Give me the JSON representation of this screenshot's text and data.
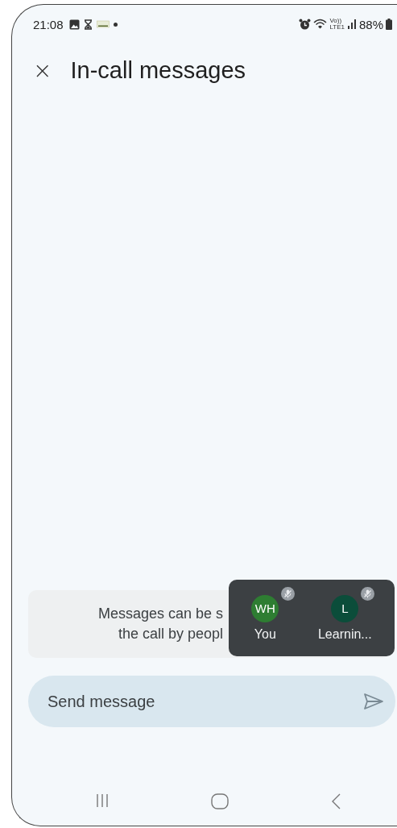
{
  "status_bar": {
    "time": "21:08",
    "network_top": "Vo))",
    "network_bottom": "LTE1",
    "battery": "88%"
  },
  "header": {
    "close": "×",
    "title": "In-call messages"
  },
  "info_card": {
    "lines": [
      "Messages can be s",
      "the call by peopl"
    ]
  },
  "participants": [
    {
      "initials": "WH",
      "name": "You",
      "color": "#2e7d32",
      "muted": true
    },
    {
      "initials": "L",
      "name": "Learnin...",
      "color": "#0b4d3a",
      "muted": true
    }
  ],
  "composer": {
    "placeholder": "Send message"
  }
}
